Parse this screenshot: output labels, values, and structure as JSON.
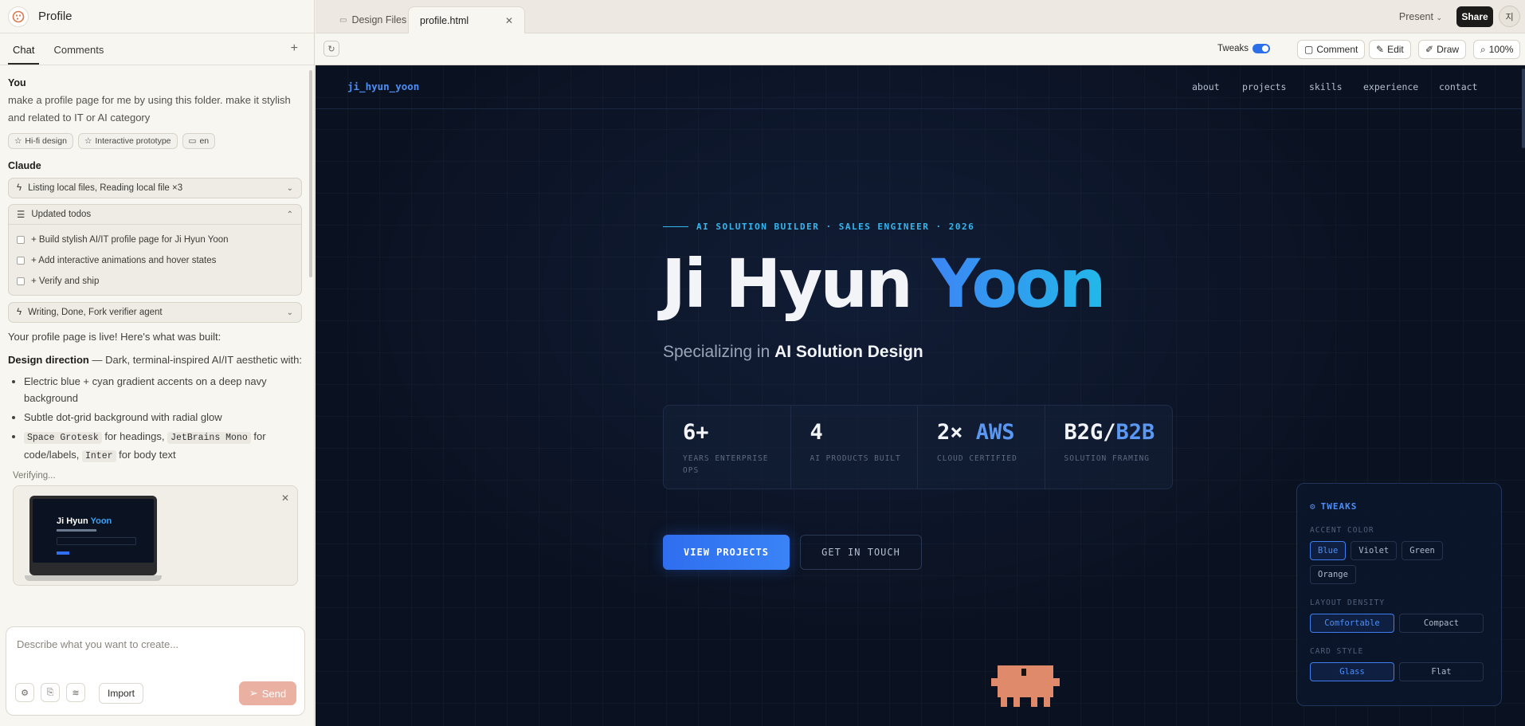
{
  "left": {
    "title": "Profile",
    "tabs": [
      "Chat",
      "Comments"
    ],
    "plus": "+",
    "user_label": "You",
    "user_message": "make a profile page for me by using this folder. make it stylish and related to IT or AI category",
    "chips": [
      "Hi-fi design",
      "Interactive prototype",
      "en"
    ],
    "assistant_label": "Claude",
    "tool1": "Listing local files, Reading local file ×3",
    "todos_title": "Updated todos",
    "todos": [
      "+ Build stylish AI/IT profile page for Ji Hyun Yoon",
      "+ Add interactive animations and hover states",
      "+ Verify and ship"
    ],
    "tool2": "Writing, Done, Fork verifier agent",
    "live_text": "Your profile page is live! Here's what was built:",
    "design_bold": "Design direction",
    "design_text": " — Dark, terminal-inspired AI/IT aesthetic with:",
    "bullets": {
      "b1": "Electric blue + cyan gradient accents on a deep navy background",
      "b2": "Subtle dot-grid background with radial glow",
      "b3_code1": "Space Grotesk",
      "b3_t1": " for headings, ",
      "b3_code2": "JetBrains Mono",
      "b3_t2": " for code/labels, ",
      "b3_code3": "Inter",
      "b3_t3": " for body text"
    },
    "verifying": "Verifying...",
    "thumb_title_a": "Ji Hyun ",
    "thumb_title_b": "Yoon",
    "composer_placeholder": "Describe what you want to create...",
    "import_label": "Import",
    "send_label": "Send"
  },
  "tabbar": {
    "tabs": [
      "Design Files",
      "profile.html"
    ],
    "present": "Present",
    "share": "Share",
    "avatar": "지"
  },
  "toolbar": {
    "tweaks": "Tweaks",
    "tweaks_on": true,
    "comment": "Comment",
    "edit": "Edit",
    "draw": "Draw",
    "zoom": "100%"
  },
  "preview": {
    "brand": "ji_hyun_yoon",
    "nav": [
      "about",
      "projects",
      "skills",
      "experience",
      "contact"
    ],
    "eyebrow": "AI SOLUTION BUILDER · SALES ENGINEER · 2026",
    "name_a": "Ji Hyun ",
    "name_b": "Yoon",
    "subtitle_a": "Specializing in ",
    "subtitle_b": "AI Solution Design",
    "stats": [
      {
        "value": "6+",
        "highlight": "",
        "label": "YEARS ENTERPRISE OPS"
      },
      {
        "value": "4",
        "highlight": "",
        "label": "AI PRODUCTS BUILT"
      },
      {
        "value": "2× ",
        "highlight": "AWS",
        "label": "CLOUD CERTIFIED"
      },
      {
        "value": "B2G/",
        "highlight": "B2B",
        "label": "SOLUTION FRAMING"
      }
    ],
    "cta_primary": "VIEW PROJECTS",
    "cta_secondary": "GET IN TOUCH",
    "tweaks_panel": {
      "title": "TWEAKS",
      "accent_label": "ACCENT COLOR",
      "accent_options": [
        "Blue",
        "Violet",
        "Green",
        "Orange"
      ],
      "accent_selected": "Blue",
      "density_label": "LAYOUT DENSITY",
      "density_options": [
        "Comfortable",
        "Compact"
      ],
      "density_selected": "Comfortable",
      "card_label": "CARD STYLE",
      "card_options": [
        "Glass",
        "Flat"
      ],
      "card_selected": "Glass"
    }
  },
  "colors": {
    "accent_blue": "#2f6ef0",
    "accent_cyan": "#22b8e8",
    "navy_bg": "#0a1120",
    "mascot": "#e08a6c",
    "send_disabled": "#eab0a2"
  }
}
